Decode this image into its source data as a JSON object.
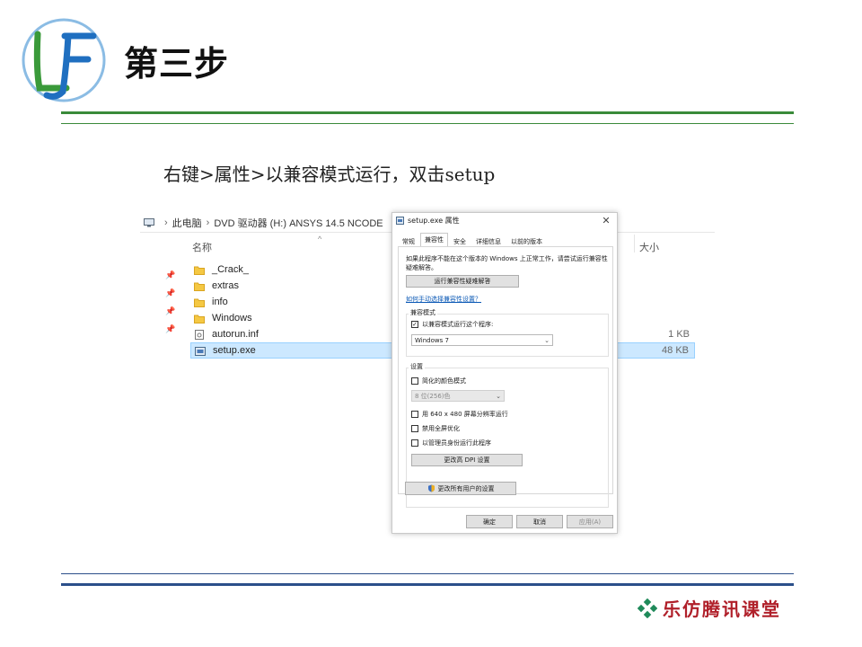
{
  "slide": {
    "logo_text": "LF",
    "title": "第三步",
    "instruction": "右键>属性>以兼容模式运行，双击setup",
    "brand": "乐仿腾讯课堂"
  },
  "explorer": {
    "breadcrumb": [
      "此电脑",
      "DVD 驱动器 (H:) ANSYS 14.5 NCODE"
    ],
    "col_name": "名称",
    "col_size": "大小",
    "files": [
      {
        "name": "_Crack_",
        "type": "folder",
        "size": "",
        "selected": false
      },
      {
        "name": "extras",
        "type": "folder",
        "size": "",
        "selected": false
      },
      {
        "name": "info",
        "type": "folder",
        "size": "",
        "selected": false
      },
      {
        "name": "Windows",
        "type": "folder",
        "size": "",
        "selected": false
      },
      {
        "name": "autorun.inf",
        "type": "inf",
        "size": "1 KB",
        "selected": false
      },
      {
        "name": "setup.exe",
        "type": "exe",
        "size": "48 KB",
        "selected": true
      }
    ]
  },
  "dialog": {
    "title": "setup.exe 属性",
    "tabs": [
      "常规",
      "兼容性",
      "安全",
      "详细信息",
      "以前的版本"
    ],
    "active_tab": 1,
    "intro": "如果此程序不能在这个版本的 Windows 上正常工作，请尝试运行兼容性疑难解答。",
    "troubleshoot_button": "运行兼容性疑难解答",
    "manual_link": "如何手动选择兼容性设置？",
    "compat_group_label": "兼容模式",
    "compat_checkbox": {
      "label": "以兼容模式运行这个程序:",
      "checked": true
    },
    "compat_select": "Windows 7",
    "settings_group_label": "设置",
    "settings": [
      {
        "label": "简化的颜色模式",
        "checked": false
      },
      {
        "label": "用 640 x 480 屏幕分辨率运行",
        "checked": false
      },
      {
        "label": "禁用全屏优化",
        "checked": false
      },
      {
        "label": "以管理员身份运行此程序",
        "checked": false
      }
    ],
    "color_select": "8 位(256)色",
    "dpi_button": "更改高 DPI 设置",
    "all_users_button": "更改所有用户的设置",
    "ok_button": "确定",
    "cancel_button": "取消",
    "apply_button": "应用(A)"
  },
  "colors": {
    "green_rule": "#3a8a3a",
    "blue_rule": "#2b4f8a",
    "selection": "#cce8ff",
    "brand_red": "#b0202a",
    "link_blue": "#0a58b5"
  }
}
